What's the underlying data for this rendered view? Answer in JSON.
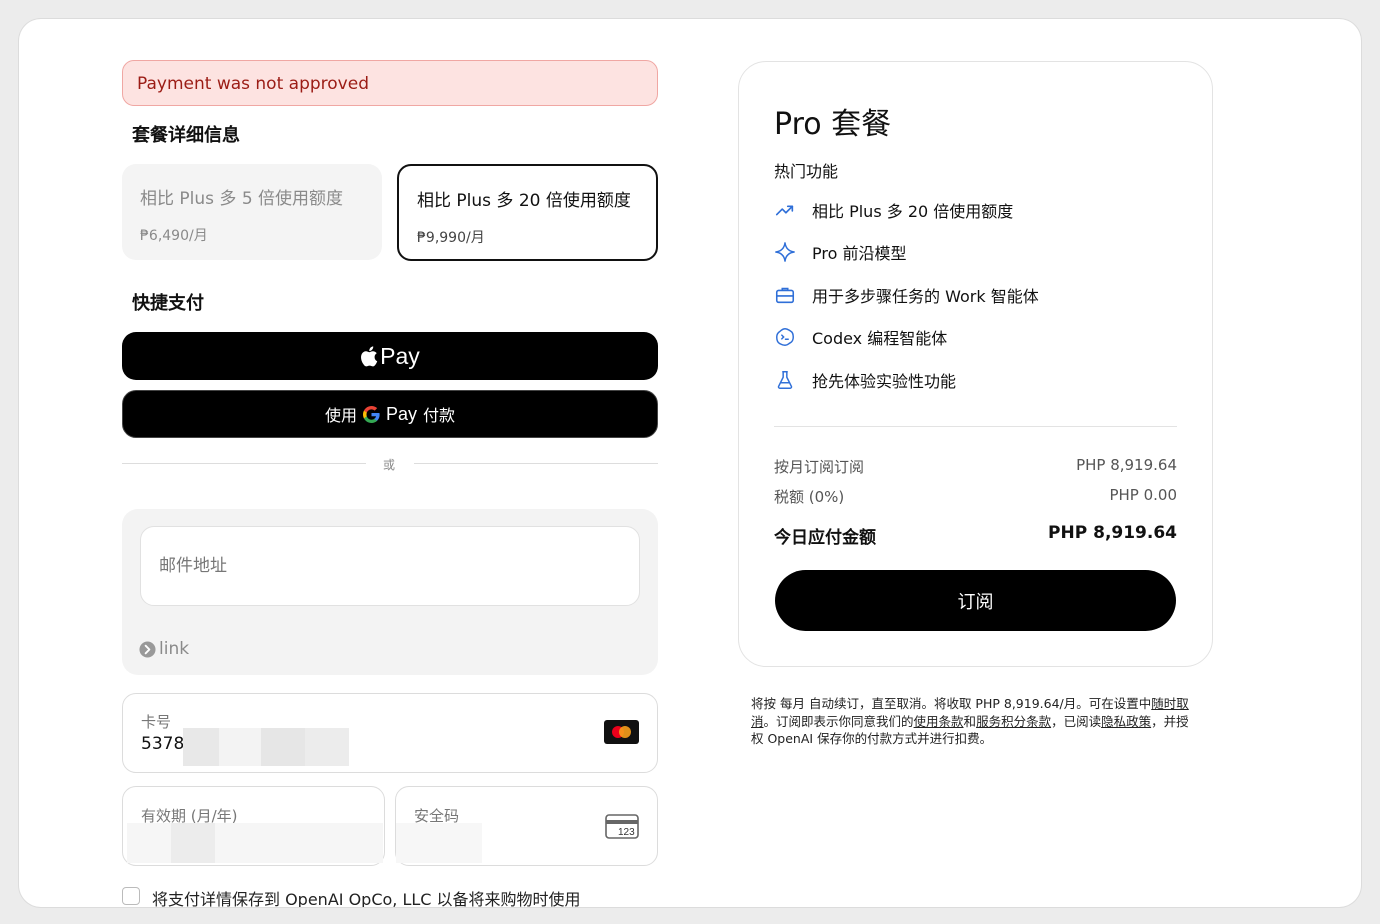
{
  "error": {
    "message": "Payment was not approved"
  },
  "plan_details": {
    "title": "套餐详细信息",
    "options": [
      {
        "name": "相比 Plus 多 5 倍使用额度",
        "price": "₱6,490/月",
        "selected": false
      },
      {
        "name": "相比 Plus 多 20 倍使用额度",
        "price": "₱9,990/月",
        "selected": true
      }
    ]
  },
  "express": {
    "title": "快捷支付",
    "apple_pay_label": "Pay",
    "gpay_prefix": "使用",
    "gpay_word": "Pay",
    "gpay_suffix": "付款",
    "or_label": "或"
  },
  "form": {
    "email_placeholder": "邮件地址",
    "link_label": "link",
    "card_number_label": "卡号",
    "card_number_value": "5378",
    "expiry_label": "有效期 (月/年)",
    "cvc_label": "安全码",
    "cvc_icon_text": "123",
    "save_details_label": "将支付详情保存到 OpenAI OpCo, LLC 以备将来购物时使用"
  },
  "summary": {
    "title": "Pro 套餐",
    "features_title": "热门功能",
    "features": [
      {
        "icon": "trending-up-icon",
        "label": "相比 Plus 多 20 倍使用额度"
      },
      {
        "icon": "sparkle-icon",
        "label": "Pro 前沿模型"
      },
      {
        "icon": "briefcase-icon",
        "label": "用于多步骤任务的 Work 智能体"
      },
      {
        "icon": "codex-icon",
        "label": "Codex 编程智能体"
      },
      {
        "icon": "flask-icon",
        "label": "抢先体验实验性功能"
      }
    ],
    "monthly_label": "按月订阅订阅",
    "monthly_value": "PHP 8,919.64",
    "tax_label": "税额 (0%)",
    "tax_value": "PHP 0.00",
    "total_label": "今日应付金额",
    "total_value": "PHP 8,919.64",
    "subscribe_label": "订阅"
  },
  "legal": {
    "part1": "将按 每月 自动续订，直至取消。将收取 PHP 8,919.64/月。可在设置中",
    "link_cancel": "随时取消",
    "part2": "。订阅即表示你同意我们的",
    "link_terms": "使用条款",
    "part3": "和",
    "link_points": "服务积分条款",
    "part4": "，已阅读",
    "link_privacy": "隐私政策",
    "part5": "，并授权 OpenAI 保存你的付款方式并进行扣费。"
  },
  "colors": {
    "error_bg": "#fde3e1",
    "error_text": "#9b1c15",
    "accent": "#2f6fd8",
    "button": "#000000"
  }
}
